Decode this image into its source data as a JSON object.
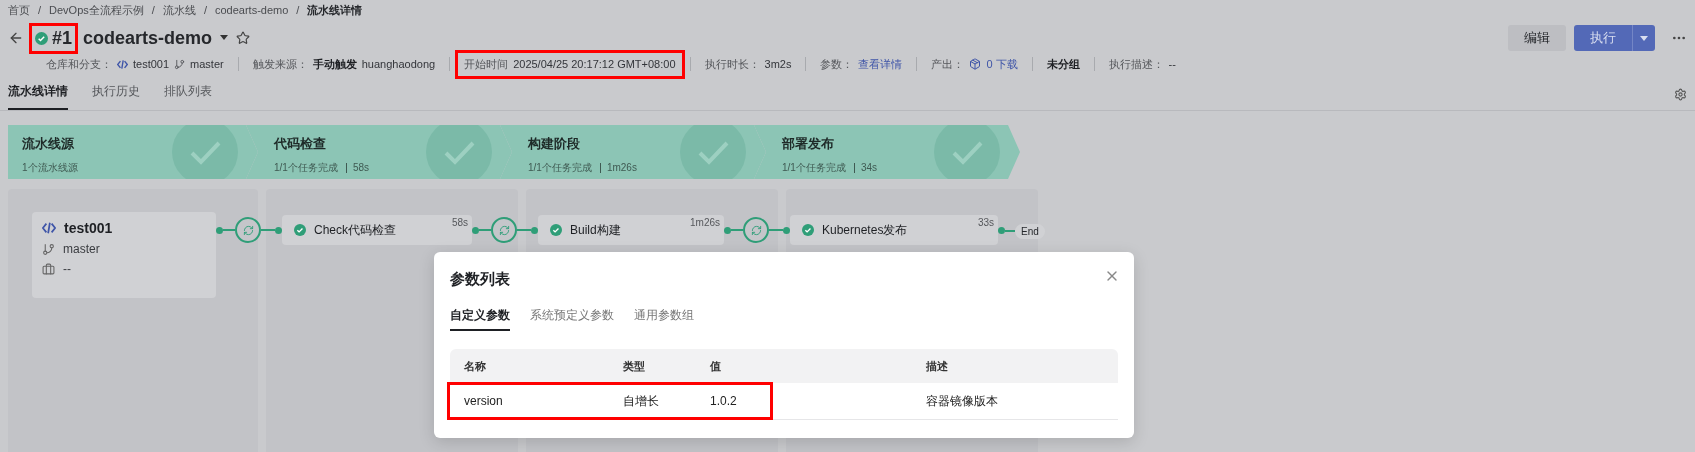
{
  "breadcrumb": {
    "separator": "/",
    "items": [
      "首页",
      "DevOps全流程示例",
      "流水线",
      "codearts-demo",
      "流水线详情"
    ]
  },
  "header": {
    "run_number": "#1",
    "highlighted": true,
    "name": "codearts-demo",
    "starred": false,
    "buttons": [
      {
        "label": "编辑",
        "kind": "secondary"
      },
      {
        "label": "执行",
        "kind": "split"
      }
    ]
  },
  "meta": [
    {
      "kind": "repo",
      "label": "仓库和分支：",
      "repo": "test001",
      "branch": "master",
      "highlighted": false
    },
    {
      "kind": "text",
      "label": "触发来源：",
      "strong": "手动触发",
      "value": "huanghaodong",
      "highlighted": false
    },
    {
      "kind": "text",
      "label": "开始时间",
      "value": "2025/04/25 20:17:12 GMT+08:00",
      "highlighted": true
    },
    {
      "kind": "text",
      "label": "执行时长：",
      "value": "3m2s",
      "highlighted": false
    },
    {
      "kind": "text",
      "label": "参数：",
      "link": "查看详情",
      "highlighted": false
    },
    {
      "kind": "artifact",
      "label": "产出：",
      "link": "0 下载",
      "highlighted": false
    },
    {
      "kind": "text",
      "strong": "未分组",
      "highlighted": false
    },
    {
      "kind": "text",
      "label": "执行描述：",
      "value": "--",
      "highlighted": false
    }
  ],
  "tabs": [
    {
      "label": "流水线详情",
      "selected": true
    },
    {
      "label": "执行历史",
      "selected": false
    },
    {
      "label": "排队列表",
      "selected": false
    }
  ],
  "stages": [
    {
      "name": "流水线源",
      "summary": "1个流水线源"
    },
    {
      "name": "代码检查",
      "summary": "1/1个任务完成",
      "duration": "58s"
    },
    {
      "name": "构建阶段",
      "summary": "1/1个任务完成",
      "duration": "1m26s"
    },
    {
      "name": "部署发布",
      "summary": "1/1个任务完成",
      "duration": "34s"
    }
  ],
  "source": {
    "repo": "test001",
    "branch": "master",
    "artifact": "--"
  },
  "jobs": [
    {
      "name": "Check代码检查",
      "duration": "58s"
    },
    {
      "name": "Build构建",
      "duration": "1m26s"
    },
    {
      "name": "Kubernetes发布",
      "duration": "33s"
    }
  ],
  "end_label": "End",
  "modal": {
    "title": "参数列表",
    "tabs": [
      {
        "label": "自定义参数",
        "selected": true
      },
      {
        "label": "系统预定义参数",
        "selected": false
      },
      {
        "label": "通用参数组",
        "selected": false
      }
    ],
    "columns": [
      "名称",
      "类型",
      "值",
      "描述"
    ],
    "rows": [
      {
        "name": "version",
        "type": "自增长",
        "value": "1.0.2",
        "description": "容器镜像版本",
        "highlighted": true
      }
    ]
  }
}
